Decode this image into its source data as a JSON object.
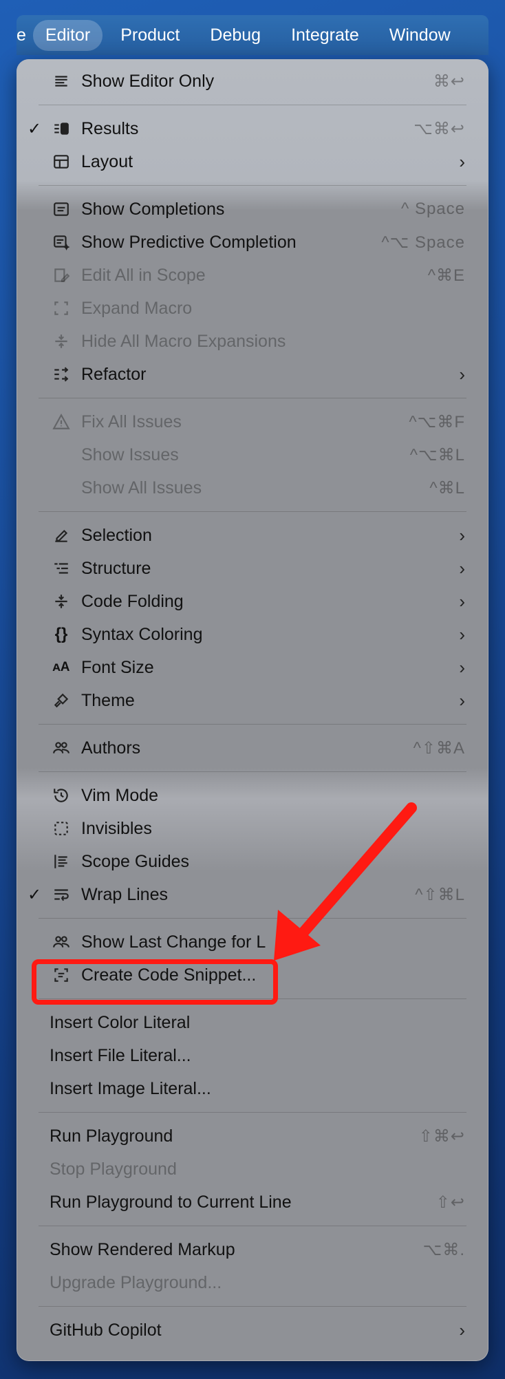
{
  "menubar": {
    "edge_fragment": "e",
    "items": [
      "Editor",
      "Product",
      "Debug",
      "Integrate",
      "Window"
    ],
    "active": "Editor"
  },
  "menu": {
    "show_editor_only": {
      "label": "Show Editor Only",
      "shortcut": "⌘↩"
    },
    "results": {
      "label": "Results",
      "shortcut": "⌥⌘↩",
      "checked": "✓"
    },
    "layout": {
      "label": "Layout",
      "submenu": "›"
    },
    "show_completions": {
      "label": "Show Completions",
      "shortcut": "^ Space"
    },
    "show_predictive": {
      "label": "Show Predictive Completion",
      "shortcut": "^⌥ Space"
    },
    "edit_all_in_scope": {
      "label": "Edit All in Scope",
      "shortcut": "^⌘E"
    },
    "expand_macro": {
      "label": "Expand Macro"
    },
    "hide_macro": {
      "label": "Hide All Macro Expansions"
    },
    "refactor": {
      "label": "Refactor",
      "submenu": "›"
    },
    "fix_all_issues": {
      "label": "Fix All Issues",
      "shortcut": "^⌥⌘F"
    },
    "show_issues": {
      "label": "Show Issues",
      "shortcut": "^⌥⌘L"
    },
    "show_all_issues": {
      "label": "Show All Issues",
      "shortcut": "^⌘L"
    },
    "selection": {
      "label": "Selection",
      "submenu": "›"
    },
    "structure": {
      "label": "Structure",
      "submenu": "›"
    },
    "code_folding": {
      "label": "Code Folding",
      "submenu": "›"
    },
    "syntax_coloring": {
      "label": "Syntax Coloring",
      "submenu": "›"
    },
    "font_size": {
      "label": "Font Size",
      "submenu": "›"
    },
    "theme": {
      "label": "Theme",
      "submenu": "›"
    },
    "authors": {
      "label": "Authors",
      "shortcut": "^⇧⌘A"
    },
    "vim_mode": {
      "label": "Vim Mode"
    },
    "invisibles": {
      "label": "Invisibles"
    },
    "scope_guides": {
      "label": "Scope Guides"
    },
    "wrap_lines": {
      "label": "Wrap Lines",
      "shortcut": "^⇧⌘L",
      "checked": "✓"
    },
    "show_last_change": {
      "label": "Show Last Change for L"
    },
    "create_snippet": {
      "label": "Create Code Snippet..."
    },
    "insert_color": {
      "label": "Insert Color Literal"
    },
    "insert_file": {
      "label": "Insert File Literal..."
    },
    "insert_image": {
      "label": "Insert Image Literal..."
    },
    "run_playground": {
      "label": "Run Playground",
      "shortcut": "⇧⌘↩"
    },
    "stop_playground": {
      "label": "Stop Playground"
    },
    "run_to_line": {
      "label": "Run Playground to Current Line",
      "shortcut": "⇧↩"
    },
    "show_markup": {
      "label": "Show Rendered Markup",
      "shortcut": "⌥⌘."
    },
    "upgrade_playground": {
      "label": "Upgrade Playground..."
    },
    "github_copilot": {
      "label": "GitHub Copilot",
      "submenu": "›"
    }
  },
  "colors": {
    "annotation": "#ff1a12",
    "menubar": "#255ea0"
  }
}
